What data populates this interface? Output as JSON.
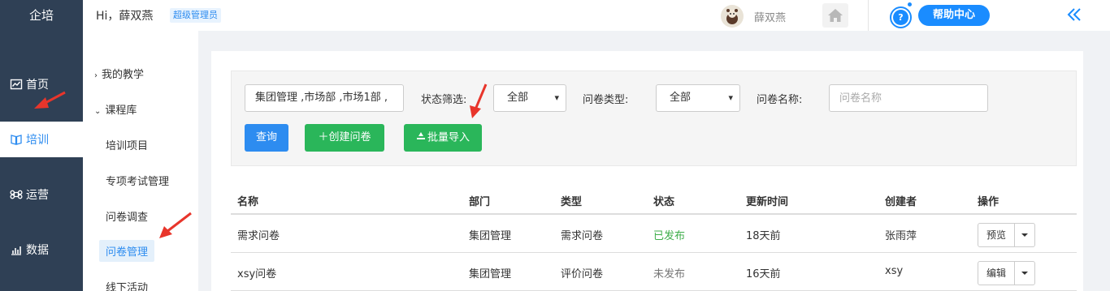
{
  "brand": "企培",
  "main_nav": [
    {
      "label": "首页",
      "icon": "chart-line-icon",
      "active": false
    },
    {
      "label": "培训",
      "icon": "book-icon",
      "active": true
    },
    {
      "label": "运营",
      "icon": "command-icon",
      "active": false
    },
    {
      "label": "数据",
      "icon": "bar-chart-icon",
      "active": false
    }
  ],
  "header": {
    "greeting": "Hi，薛双燕",
    "role_badge": "超级管理员",
    "user_name": "薛双燕",
    "help_label": "帮助中心",
    "help_q": "?"
  },
  "sub_nav": {
    "groups": [
      "我的教学",
      "课程库"
    ],
    "items": [
      "培训项目",
      "专项考试管理",
      "问卷调查",
      "问卷管理",
      "线下活动"
    ],
    "active_item": "问卷管理"
  },
  "filters": {
    "department_value": "集团管理 ,市场部 ,市场1部 ,",
    "status_label": "状态筛选:",
    "status_value": "全部",
    "type_label": "问卷类型:",
    "type_value": "全部",
    "name_label": "问卷名称:",
    "name_placeholder": "问卷名称"
  },
  "buttons": {
    "query": "查询",
    "create": "＋创建问卷",
    "import": "批量导入"
  },
  "table": {
    "headers": [
      "名称",
      "部门",
      "类型",
      "状态",
      "更新时间",
      "创建者",
      "操作"
    ],
    "rows": [
      {
        "name": "需求问卷",
        "dept": "集团管理",
        "type": "需求问卷",
        "status": "已发布",
        "updated": "18天前",
        "creator": "张雨萍",
        "action": "预览"
      },
      {
        "name": "xsy问卷",
        "dept": "集团管理",
        "type": "评价问卷",
        "status": "未发布",
        "updated": "16天前",
        "creator": "xsy",
        "action": "编辑"
      }
    ]
  },
  "colors": {
    "sidebar_bg": "#2f4055",
    "primary": "#2d8cf0",
    "success": "#2ab65a",
    "annotation": "#e8352b"
  }
}
